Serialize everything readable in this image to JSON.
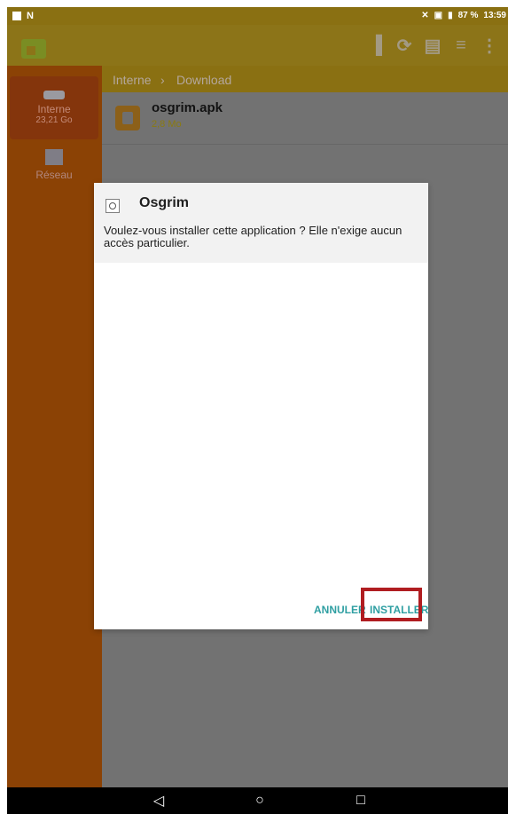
{
  "status_bar": {
    "battery": "87 %",
    "time": "13:59"
  },
  "breadcrumb": {
    "root": "Interne",
    "current": "Download"
  },
  "sidebar": {
    "items": [
      {
        "label": "Interne",
        "sub": "23,21 Go"
      },
      {
        "label": "Réseau",
        "sub": ""
      }
    ]
  },
  "file": {
    "name": "osgrim.apk",
    "size": "2,8 Mo"
  },
  "dialog": {
    "title": "Osgrim",
    "message": "Voulez-vous installer cette application ? Elle n'exige aucun accès particulier.",
    "cancel_label": "ANNULER",
    "install_label": "INSTALLER"
  },
  "icons": {
    "back": "back-icon",
    "home": "home-icon",
    "recents": "recents-icon"
  },
  "colors": {
    "highlight_border": "#b01d21",
    "button_teal": "#2f9fa2"
  }
}
